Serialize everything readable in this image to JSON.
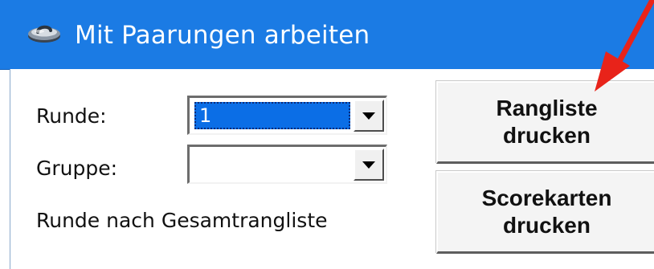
{
  "window": {
    "title": "Mit Paarungen arbeiten",
    "title_bar_color": "#1b7be4"
  },
  "form": {
    "round_label": "Runde:",
    "round_value": "1",
    "group_label": "Gruppe:",
    "group_value": "",
    "info_text": "Runde nach Gesamtrangliste"
  },
  "buttons": {
    "print_ranking_line1": "Rangliste",
    "print_ranking_line2": "drucken",
    "print_scorecards_line1": "Scorekarten",
    "print_scorecards_line2": "drucken"
  },
  "icons": {
    "title_icon": "curling-stone-icon",
    "dropdown_icon": "chevron-down-icon",
    "annotation": "red-arrow-icon"
  },
  "colors": {
    "selection": "#0b6ee6",
    "annotation_arrow": "#e8231a"
  }
}
